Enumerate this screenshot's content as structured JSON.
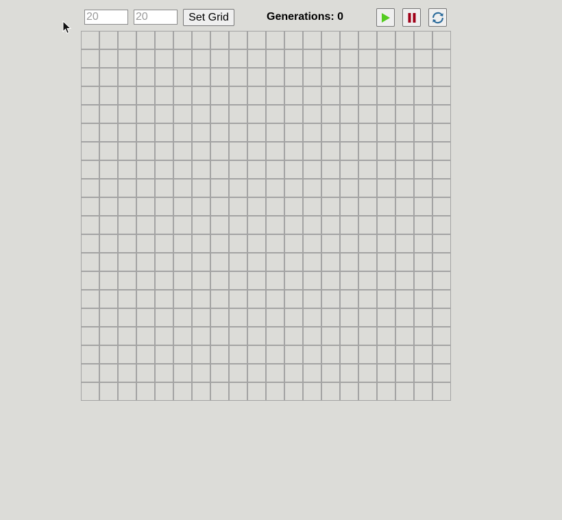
{
  "controls": {
    "rows_placeholder": "20",
    "cols_placeholder": "20",
    "set_grid_label": "Set Grid",
    "generations_label": "Generations: 0"
  },
  "buttons": {
    "play_icon": "play-icon",
    "pause_icon": "pause-icon",
    "reset_icon": "refresh-icon"
  },
  "grid": {
    "rows": 20,
    "cols": 20
  },
  "colors": {
    "background": "#dcdcd8",
    "grid_line": "#a3a3a3",
    "play": "#55cc22",
    "pause": "#a00018",
    "refresh": "#2a6a9a"
  }
}
